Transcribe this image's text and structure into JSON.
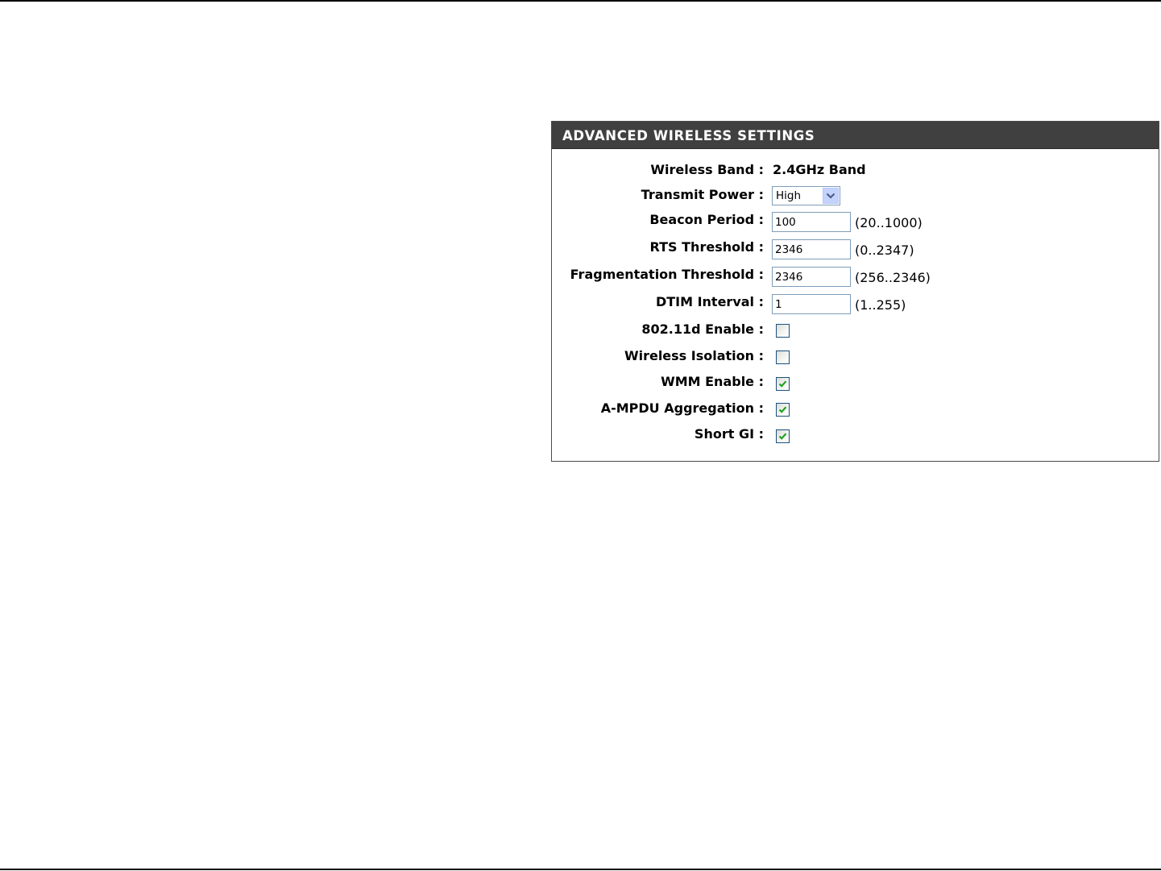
{
  "panel": {
    "title": "ADVANCED WIRELESS SETTINGS"
  },
  "fields": {
    "wireless_band": {
      "label": "Wireless Band :",
      "value": "2.4GHz Band"
    },
    "transmit_power": {
      "label": "Transmit Power :",
      "selected": "High"
    },
    "beacon_period": {
      "label": "Beacon Period :",
      "value": "100",
      "range": "(20..1000)"
    },
    "rts_threshold": {
      "label": "RTS Threshold :",
      "value": "2346",
      "range": "(0..2347)"
    },
    "fragmentation_threshold": {
      "label": "Fragmentation Threshold :",
      "value": "2346",
      "range": "(256..2346)"
    },
    "dtim_interval": {
      "label": "DTIM Interval :",
      "value": "1",
      "range": "(1..255)"
    },
    "enable_80211d": {
      "label": "802.11d Enable :",
      "checked": false
    },
    "wireless_isolation": {
      "label": "Wireless Isolation :",
      "checked": false
    },
    "wmm_enable": {
      "label": "WMM Enable :",
      "checked": true
    },
    "ampdu_aggregation": {
      "label": "A-MPDU Aggregation :",
      "checked": true
    },
    "short_gi": {
      "label": "Short GI :",
      "checked": true
    }
  },
  "icons": {
    "dropdown": "chevron-down-icon",
    "checkmark": "checkmark-icon"
  },
  "colors": {
    "header_background": "#404040",
    "header_text": "#ffffff",
    "input_border": "#7f9db9",
    "checkmark": "#21a121"
  }
}
